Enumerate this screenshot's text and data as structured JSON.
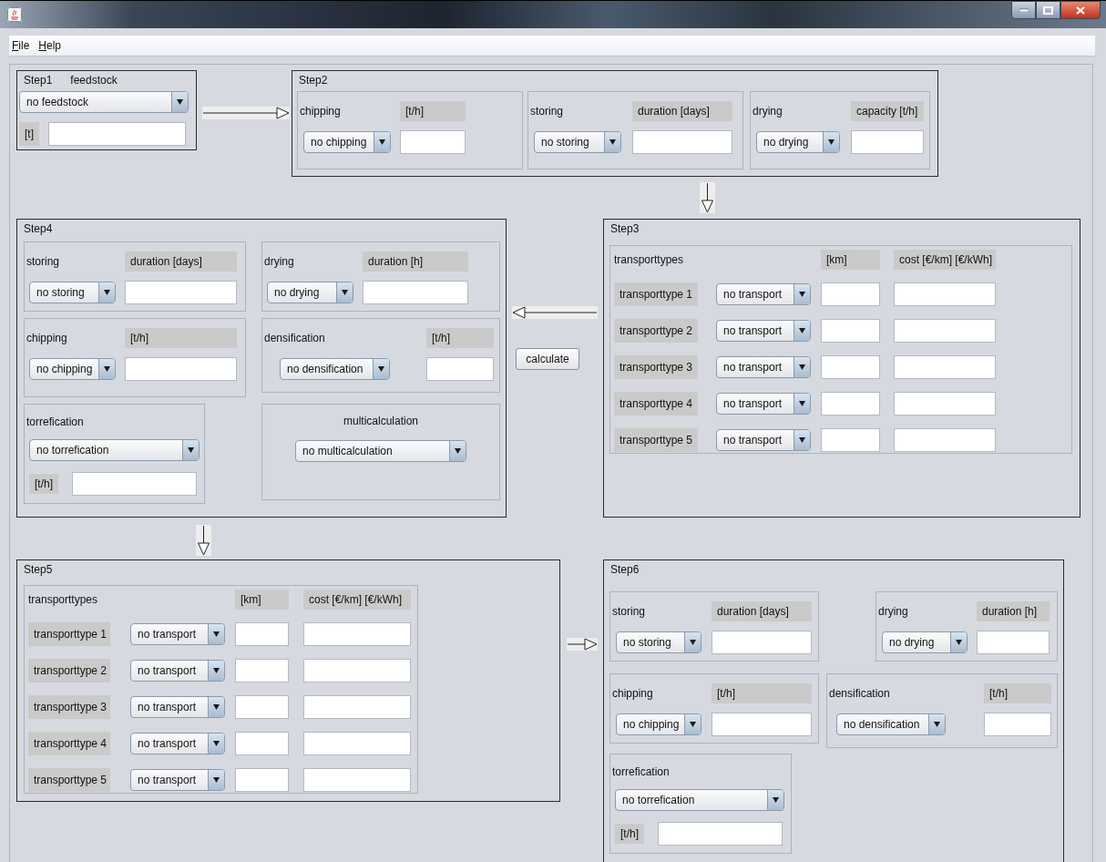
{
  "menu": [
    {
      "label": "File"
    },
    {
      "label": "Help"
    }
  ],
  "steps": [
    {
      "title": "Step1",
      "kind": "feedstock",
      "label": "feedstock",
      "dropdown": "no feedstock",
      "unit": "[t]"
    },
    {
      "title": "Step2",
      "kind": "groups",
      "groups": [
        {
          "kind": "row",
          "label": "chipping",
          "unit": "[t/h]",
          "dropdown": "no chipping"
        },
        {
          "kind": "row",
          "label": "storing",
          "unit": "duration [days]",
          "dropdown": "no storing"
        },
        {
          "kind": "row",
          "label": "drying",
          "unit": "capacity [t/h]",
          "dropdown": "no drying"
        }
      ]
    },
    {
      "title": "Step4",
      "kind": "groups",
      "groups": [
        {
          "kind": "row",
          "label": "storing",
          "unit": "duration [days]",
          "dropdown": "no storing"
        },
        {
          "kind": "row",
          "label": "drying",
          "unit": "duration [h]",
          "dropdown": "no drying"
        },
        {
          "kind": "row",
          "label": "chipping",
          "unit": "[t/h]",
          "dropdown": "no chipping"
        },
        {
          "kind": "row",
          "label": "densification",
          "unit": "[t/h]",
          "dropdown": "no densification"
        },
        {
          "kind": "stacked",
          "label": "torrefication",
          "unit": "[t/h]",
          "dropdown": "no torrefication"
        },
        {
          "kind": "centered",
          "label": "multicalculation",
          "dropdown": "no multicalculation"
        }
      ]
    },
    {
      "title": "Step3",
      "kind": "transport",
      "header": {
        "label": "transporttypes",
        "km": "[km]",
        "cost": "cost [€/km] [€/kWh]"
      },
      "rows": [
        {
          "type": "transporttype 1",
          "dropdown": "no transport"
        },
        {
          "type": "transporttype 2",
          "dropdown": "no transport"
        },
        {
          "type": "transporttype 3",
          "dropdown": "no transport"
        },
        {
          "type": "transporttype 4",
          "dropdown": "no transport"
        },
        {
          "type": "transporttype 5",
          "dropdown": "no transport"
        }
      ]
    },
    {
      "title": "Step5",
      "kind": "transport",
      "header": {
        "label": "transporttypes",
        "km": "[km]",
        "cost": "cost [€/km] [€/kWh]"
      },
      "rows": [
        {
          "type": "transporttype 1",
          "dropdown": "no transport"
        },
        {
          "type": "transporttype 2",
          "dropdown": "no transport"
        },
        {
          "type": "transporttype 3",
          "dropdown": "no transport"
        },
        {
          "type": "transporttype 4",
          "dropdown": "no transport"
        },
        {
          "type": "transporttype 5",
          "dropdown": "no transport"
        }
      ]
    },
    {
      "title": "Step6",
      "kind": "groups",
      "groups": [
        {
          "kind": "row",
          "label": "storing",
          "unit": "duration [days]",
          "dropdown": "no storing"
        },
        {
          "kind": "row",
          "label": "drying",
          "unit": "duration [h]",
          "dropdown": "no drying"
        },
        {
          "kind": "row",
          "label": "chipping",
          "unit": "[t/h]",
          "dropdown": "no chipping"
        },
        {
          "kind": "row",
          "label": "densification",
          "unit": "[t/h]",
          "dropdown": "no densification"
        },
        {
          "kind": "stacked",
          "label": "torrefication",
          "unit": "[t/h]",
          "dropdown": "no torrefication"
        }
      ]
    }
  ],
  "calculate_button": "calculate"
}
